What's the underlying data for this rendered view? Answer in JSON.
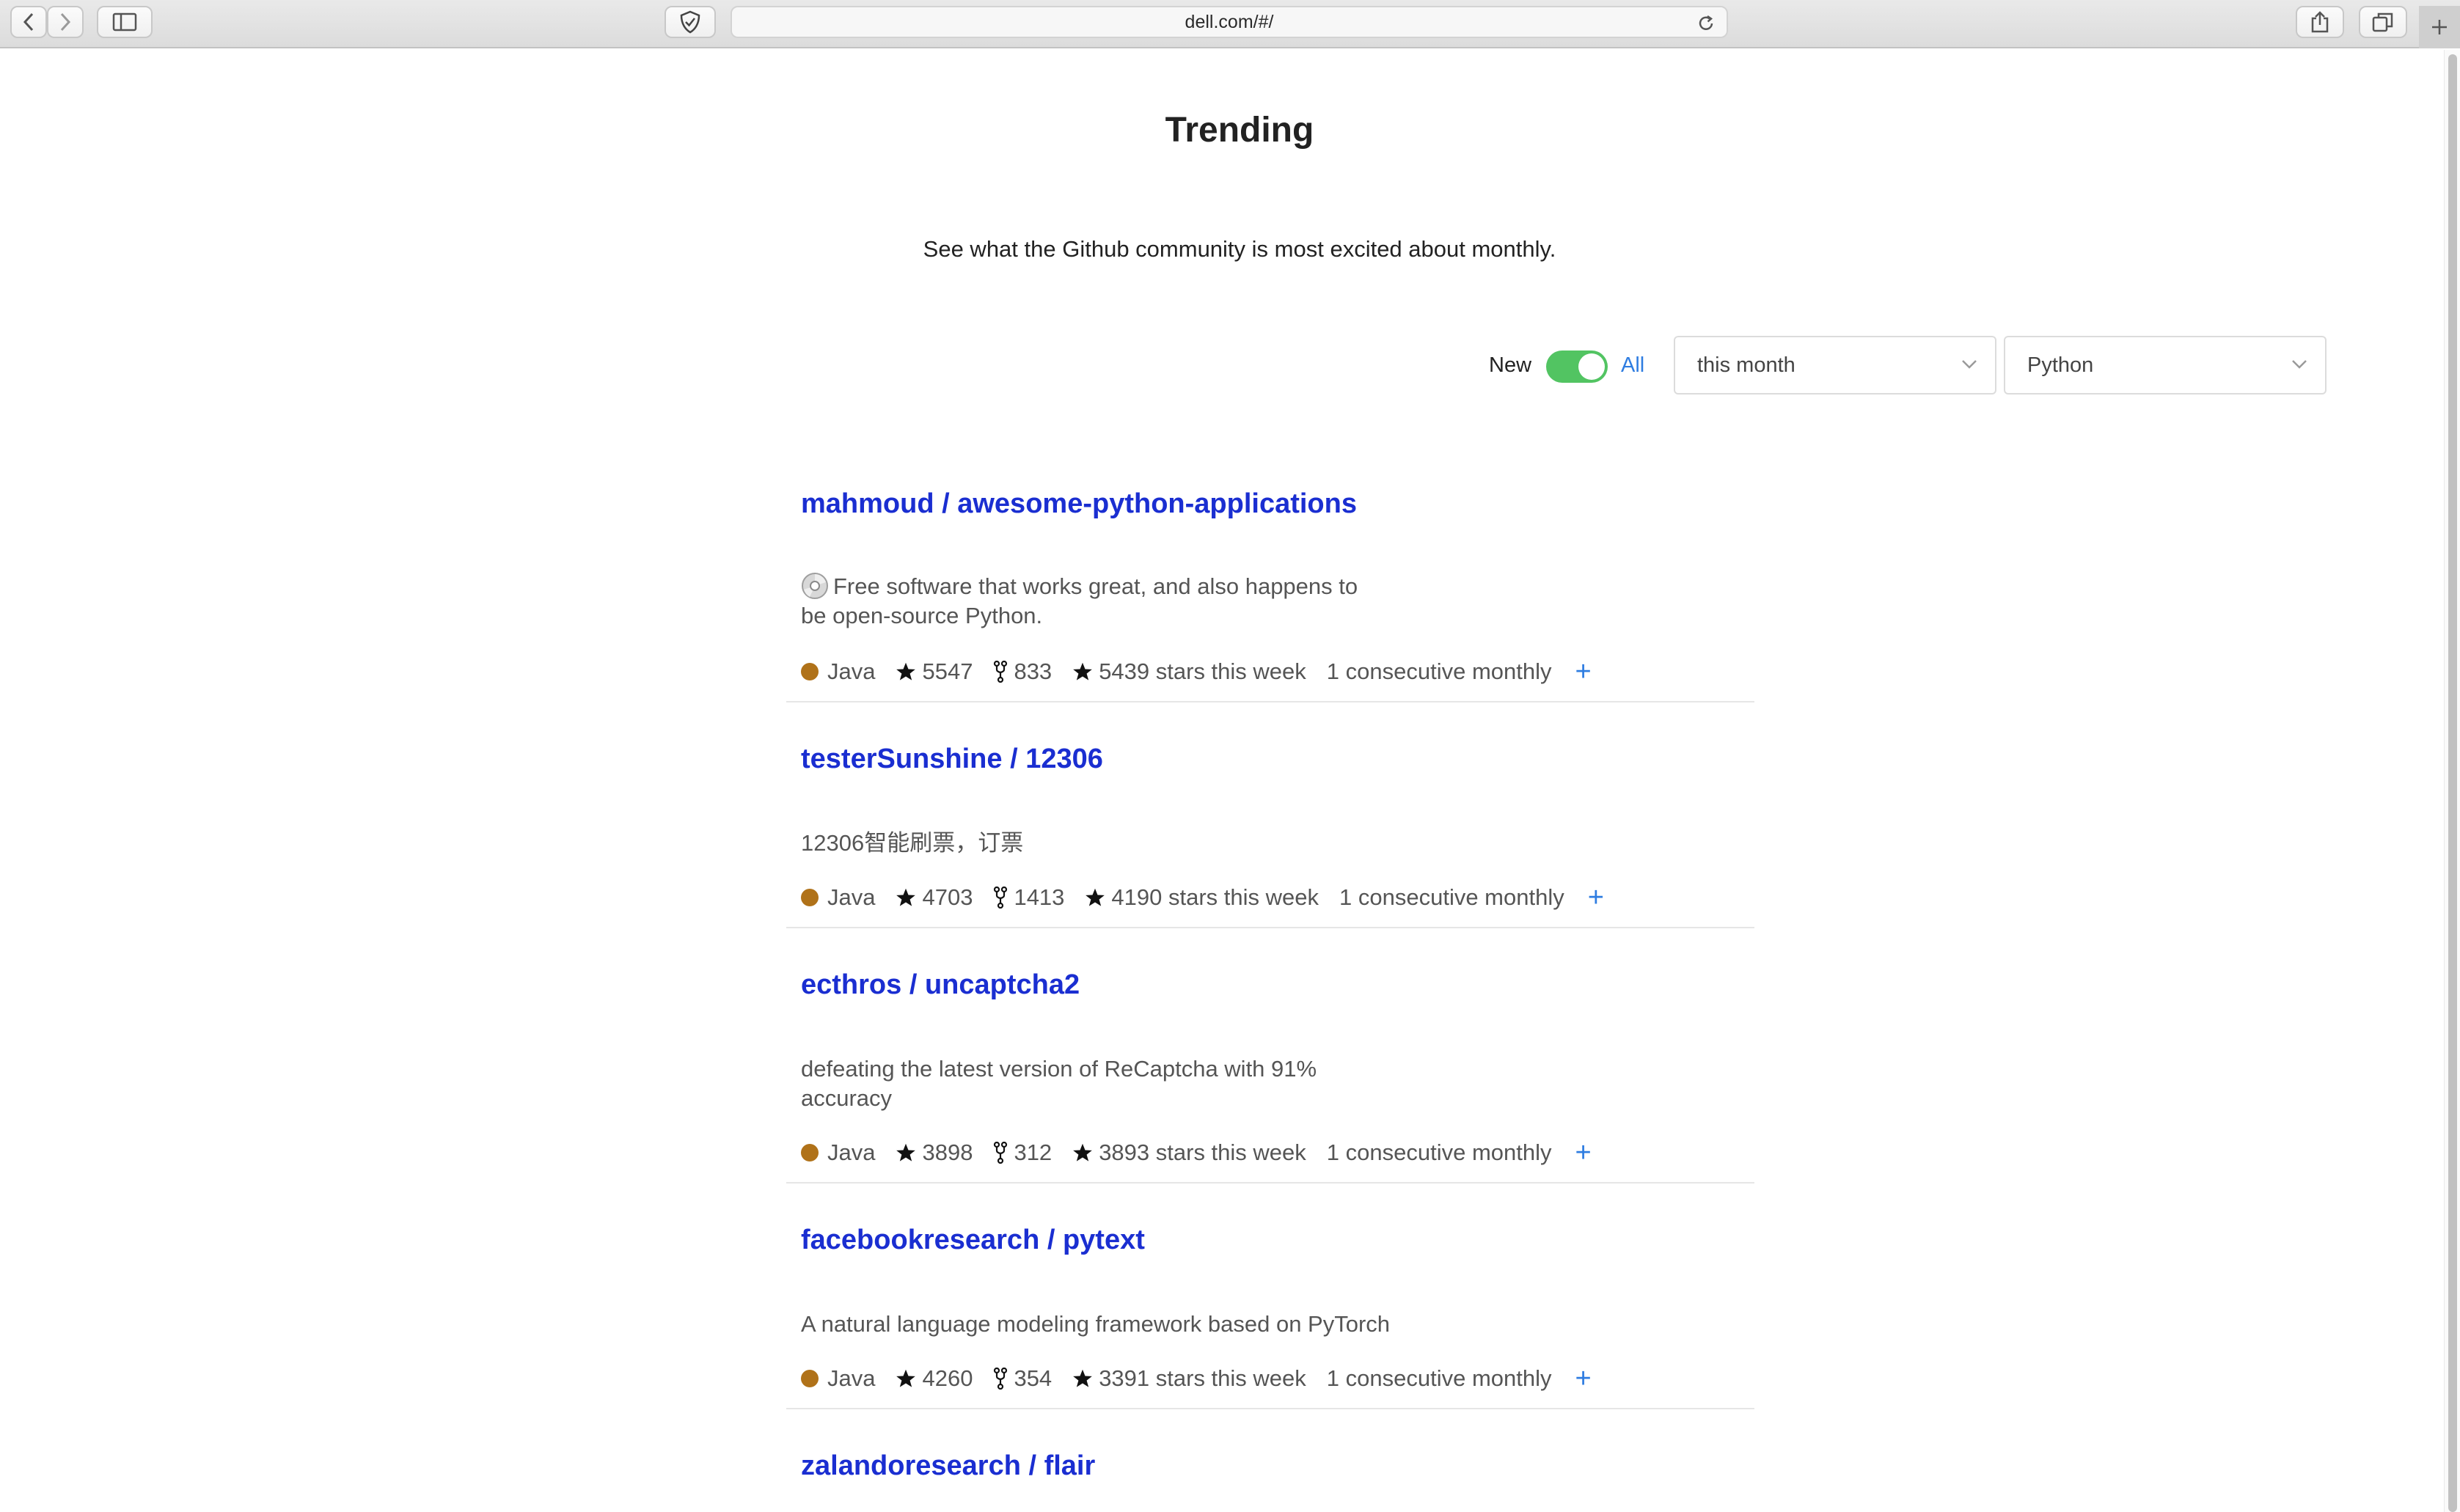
{
  "browser": {
    "url": "dell.com/#/"
  },
  "page": {
    "title": "Trending",
    "subtitle": "See what the Github community is most excited about monthly."
  },
  "filters": {
    "toggle_left_label": "New",
    "toggle_right_label": "All",
    "toggle_on": true,
    "period_select": "this month",
    "language_select": "Python"
  },
  "colors": {
    "link": "#1a2ed1",
    "accent": "#2f7de1",
    "toggle": "#52c462",
    "java_dot": "#b07219"
  },
  "repos": [
    {
      "title": "mahmoud / awesome-python-applications",
      "description_icon": "disc-icon",
      "description_line1": "Free software that works great, and also happens to",
      "description_line2": "be open-source Python.",
      "language": "Java",
      "stars": "5547",
      "forks": "833",
      "stars_this_week": "5439 stars this week",
      "consecutive": "1 consecutive monthly",
      "add_label": "+"
    },
    {
      "title": "testerSunshine / 12306",
      "description_line1": "12306智能刷票，订票",
      "description_line2": "",
      "language": "Java",
      "stars": "4703",
      "forks": "1413",
      "stars_this_week": "4190 stars this week",
      "consecutive": "1 consecutive monthly",
      "add_label": "+"
    },
    {
      "title": "ecthros / uncaptcha2",
      "description_line1": "defeating the latest version of ReCaptcha with 91%",
      "description_line2": "accuracy",
      "language": "Java",
      "stars": "3898",
      "forks": "312",
      "stars_this_week": "3893 stars this week",
      "consecutive": "1 consecutive monthly",
      "add_label": "+"
    },
    {
      "title": "facebookresearch / pytext",
      "description_line1": "A natural language modeling framework based on PyTorch",
      "description_line2": "",
      "language": "Java",
      "stars": "4260",
      "forks": "354",
      "stars_this_week": "3391 stars this week",
      "consecutive": "1 consecutive monthly",
      "add_label": "+"
    },
    {
      "title": "zalandoresearch / flair"
    }
  ]
}
